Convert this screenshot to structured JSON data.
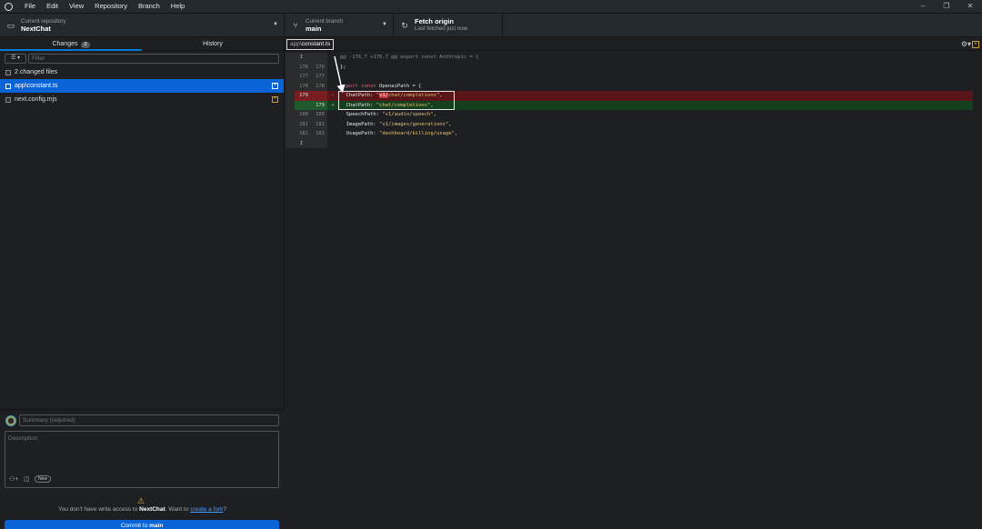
{
  "menu": [
    "File",
    "Edit",
    "View",
    "Repository",
    "Branch",
    "Help"
  ],
  "window_controls": [
    "–",
    "❐",
    "✕"
  ],
  "toolbar": {
    "repo_label": "Current repository",
    "repo_value": "NextChat",
    "branch_label": "Current branch",
    "branch_value": "main",
    "fetch_label": "Fetch origin",
    "fetch_sub": "Last fetched just now"
  },
  "tabs": {
    "changes": "Changes",
    "changes_count": "2",
    "history": "History"
  },
  "filter": {
    "placeholder": "Filter"
  },
  "changed_files_label": "2 changed files",
  "files": [
    {
      "name": "app\\constant.ts",
      "status": "modified"
    },
    {
      "name": "next.config.mjs",
      "status": "modified"
    }
  ],
  "commit": {
    "summary_placeholder": "Summary (required)",
    "description_placeholder": "Description",
    "new_badge": "New",
    "warn_prefix": "You don't have write access to ",
    "warn_repo": "NextChat",
    "warn_mid": ". Want to ",
    "warn_link": "create a fork",
    "warn_suffix": "?",
    "button_prefix": "Commit to ",
    "button_branch": "main"
  },
  "diff": {
    "path_dir": "app\\",
    "path_file": "constant.ts",
    "hunk": "@@ -176,7 +176,7 @@ export const Anthropic = {",
    "lines": [
      {
        "old": "176",
        "new": "176",
        "sign": "",
        "text": "};"
      },
      {
        "old": "177",
        "new": "177",
        "sign": "",
        "text": ""
      },
      {
        "old": "178",
        "new": "178",
        "sign": "",
        "text_kw": "export const",
        "text_rest": " OpenaiPath = {"
      },
      {
        "old": "179",
        "new": "",
        "sign": "-",
        "pre": "  ChatPath: ",
        "q1": "\"",
        "hl": "v1/",
        "q2": "chat/completions\"",
        "post": ","
      },
      {
        "old": "",
        "new": "179",
        "sign": "+",
        "pre": "  ChatPath: ",
        "str": "\"chat/completions\"",
        "post": ","
      },
      {
        "old": "180",
        "new": "180",
        "sign": "",
        "pre": "  SpeechPath: ",
        "str": "\"v1/audio/speech\"",
        "post": ","
      },
      {
        "old": "181",
        "new": "181",
        "sign": "",
        "pre": "  ImagePath: ",
        "str": "\"v1/images/generations\"",
        "post": ","
      },
      {
        "old": "182",
        "new": "182",
        "sign": "",
        "pre": "  UsagePath: ",
        "str": "\"dashboard/billing/usage\"",
        "post": ","
      }
    ]
  }
}
